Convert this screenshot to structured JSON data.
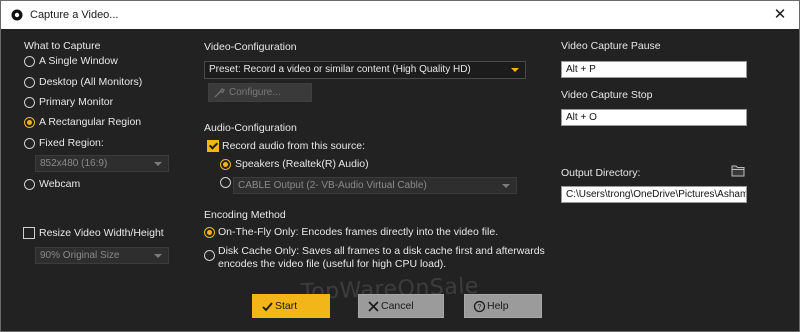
{
  "window": {
    "title": "Capture a Video..."
  },
  "what_to_capture": {
    "heading": "What to Capture",
    "options": [
      {
        "label": "A Single Window",
        "selected": false
      },
      {
        "label": "Desktop (All Monitors)",
        "selected": false
      },
      {
        "label": "Primary Monitor",
        "selected": false
      },
      {
        "label": "A Rectangular Region",
        "selected": true
      },
      {
        "label": "Fixed Region:",
        "selected": false
      },
      {
        "label": "Webcam",
        "selected": false
      }
    ],
    "fixed_region_value": "852x480 (16:9)",
    "resize_label": "Resize Video Width/Height",
    "resize_checked": false,
    "resize_value": "90% Original Size"
  },
  "video_config": {
    "heading": "Video-Configuration",
    "preset_value": "Preset: Record a video or similar content (High Quality HD)",
    "configure_label": "Configure..."
  },
  "audio_config": {
    "heading": "Audio-Configuration",
    "record_label": "Record audio from this source:",
    "record_checked": true,
    "speakers_label": "Speakers (Realtek(R) Audio)",
    "speakers_selected": true,
    "cable_value": "CABLE Output (2- VB-Audio Virtual Cable)",
    "cable_selected": false
  },
  "encoding": {
    "heading": "Encoding Method",
    "onthefly_label": "On-The-Fly Only: Encodes frames directly into the video file.",
    "onthefly_selected": true,
    "diskcache_line1": "Disk Cache Only: Saves all frames to a disk cache first and afterwards",
    "diskcache_line2": "encodes the video file (useful for high CPU load).",
    "diskcache_selected": false
  },
  "hotkeys": {
    "pause_label": "Video Capture Pause",
    "pause_value": "Alt + P",
    "stop_label": "Video Capture Stop",
    "stop_value": "Alt + O"
  },
  "output": {
    "label": "Output Directory:",
    "path": "C:\\Users\\trong\\OneDrive\\Pictures\\Ashampoo"
  },
  "buttons": {
    "start": "Start",
    "cancel": "Cancel",
    "help": "Help"
  },
  "watermark": "TopWareOnSale",
  "colors": {
    "accent": "#f2b619",
    "background": "#222222",
    "button_grey": "#9b9b9b"
  },
  "icons": [
    "app-icon",
    "close-icon",
    "folder-icon",
    "check-icon",
    "x-icon",
    "help-icon",
    "wrench-icon"
  ]
}
